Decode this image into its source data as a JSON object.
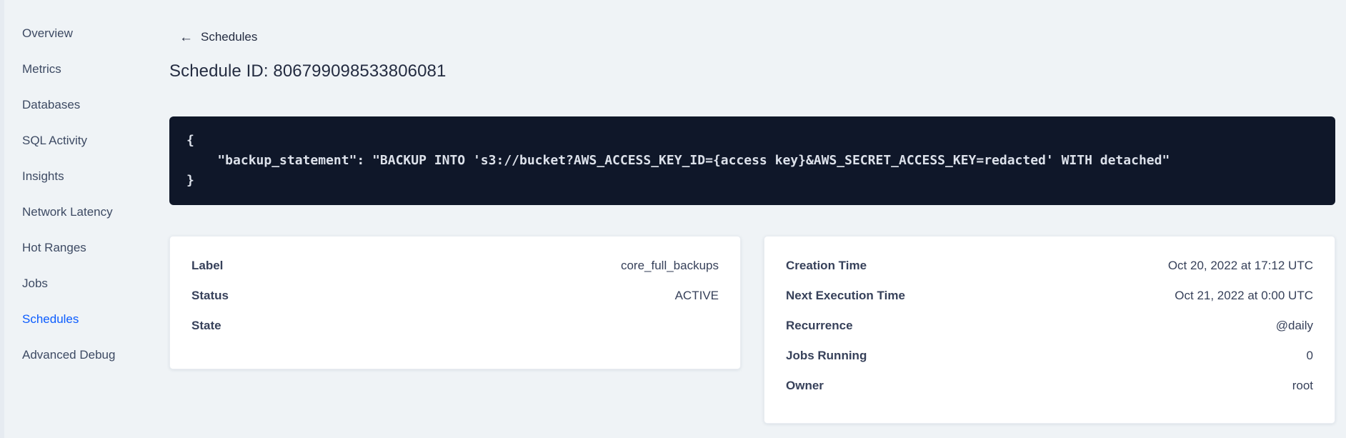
{
  "sidebar": {
    "items": [
      {
        "label": "Overview"
      },
      {
        "label": "Metrics"
      },
      {
        "label": "Databases"
      },
      {
        "label": "SQL Activity"
      },
      {
        "label": "Insights"
      },
      {
        "label": "Network Latency"
      },
      {
        "label": "Hot Ranges"
      },
      {
        "label": "Jobs"
      },
      {
        "label": "Schedules"
      },
      {
        "label": "Advanced Debug"
      }
    ],
    "active_item": "Schedules"
  },
  "header": {
    "back_label": "Schedules",
    "back_arrow": "←",
    "title": "Schedule ID: 806799098533806081"
  },
  "code_block": {
    "content": "{\n    \"backup_statement\": \"BACKUP INTO 's3://bucket?AWS_ACCESS_KEY_ID={access key}&AWS_SECRET_ACCESS_KEY=redacted' WITH detached\"\n}"
  },
  "details_card": {
    "rows": [
      {
        "label": "Label",
        "value": "core_full_backups"
      },
      {
        "label": "Status",
        "value": "ACTIVE"
      },
      {
        "label": "State",
        "value": ""
      }
    ]
  },
  "schedule_card": {
    "rows": [
      {
        "label": "Creation Time",
        "value": "Oct 20, 2022 at 17:12 UTC"
      },
      {
        "label": "Next Execution Time",
        "value": "Oct 21, 2022 at 0:00 UTC"
      },
      {
        "label": "Recurrence",
        "value": "@daily"
      },
      {
        "label": "Jobs Running",
        "value": "0"
      },
      {
        "label": "Owner",
        "value": "root"
      }
    ]
  },
  "colors": {
    "background": "#eff3f6",
    "sidebar_text": "#3d4a63",
    "active_link": "#0b5cff",
    "heading_text": "#242c41",
    "code_background": "#0f1729",
    "code_text": "#dce1ea",
    "card_background": "#ffffff",
    "card_text": "#37415a"
  }
}
